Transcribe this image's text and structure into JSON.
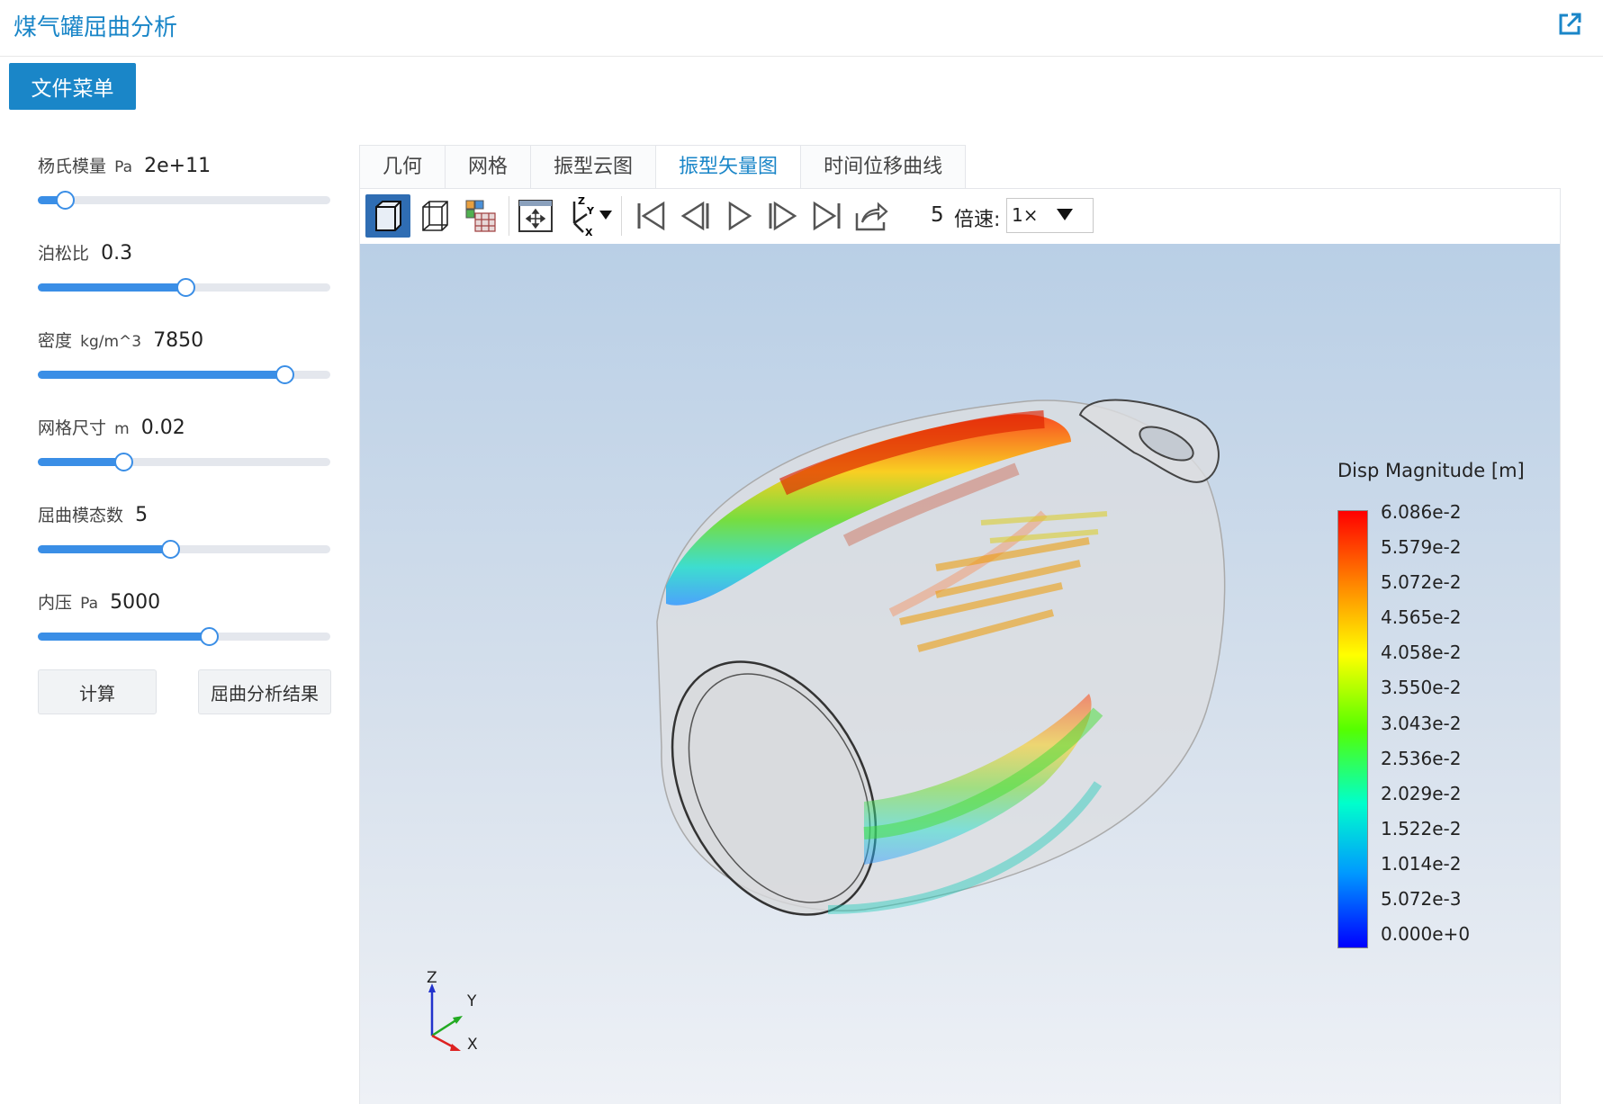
{
  "app": {
    "title": "煤气罐屈曲分析"
  },
  "menu_button": "文件菜单",
  "params": [
    {
      "label": "杨氏模量",
      "unit": "Pa",
      "value": "2e+11",
      "level": 0.09
    },
    {
      "label": "泊松比",
      "unit": "",
      "value": "0.3",
      "level": 0.5
    },
    {
      "label": "密度",
      "unit": "kg/m^3",
      "value": "7850",
      "level": 0.84
    },
    {
      "label": "网格尺寸",
      "unit": "m",
      "value": "0.02",
      "level": 0.29
    },
    {
      "label": "屈曲模态数",
      "unit": "",
      "value": "5",
      "level": 0.45
    },
    {
      "label": "内压",
      "unit": "Pa",
      "value": "5000",
      "level": 0.58
    }
  ],
  "buttons": {
    "compute": "计算",
    "results": "屈曲分析结果"
  },
  "tabs": [
    {
      "label": "几何",
      "active": false
    },
    {
      "label": "网格",
      "active": false
    },
    {
      "label": "振型云图",
      "active": false
    },
    {
      "label": "振型矢量图",
      "active": true
    },
    {
      "label": "时间位移曲线",
      "active": false
    }
  ],
  "toolbar": {
    "icons": [
      "solid-view-icon",
      "wireframe-view-icon",
      "mesh-view-icon",
      "fit-view-icon",
      "axis-orient-icon",
      "first-frame-icon",
      "prev-frame-icon",
      "play-icon",
      "next-frame-icon",
      "last-frame-icon",
      "export-icon"
    ],
    "frame": "5",
    "speed_label": "倍速:",
    "speed_value": "1×"
  },
  "legend": {
    "title": "Disp Magnitude [m]",
    "labels": [
      "6.086e-2",
      "5.579e-2",
      "5.072e-2",
      "4.565e-2",
      "4.058e-2",
      "3.550e-2",
      "3.043e-2",
      "2.536e-2",
      "2.029e-2",
      "1.522e-2",
      "1.014e-2",
      "5.072e-3",
      "0.000e+0"
    ]
  },
  "axes": {
    "x": "X",
    "y": "Y",
    "z": "Z"
  },
  "colors": {
    "accent": "#1a86c8",
    "slider": "#3a8ee6",
    "active_tool": "#2f6db3"
  }
}
